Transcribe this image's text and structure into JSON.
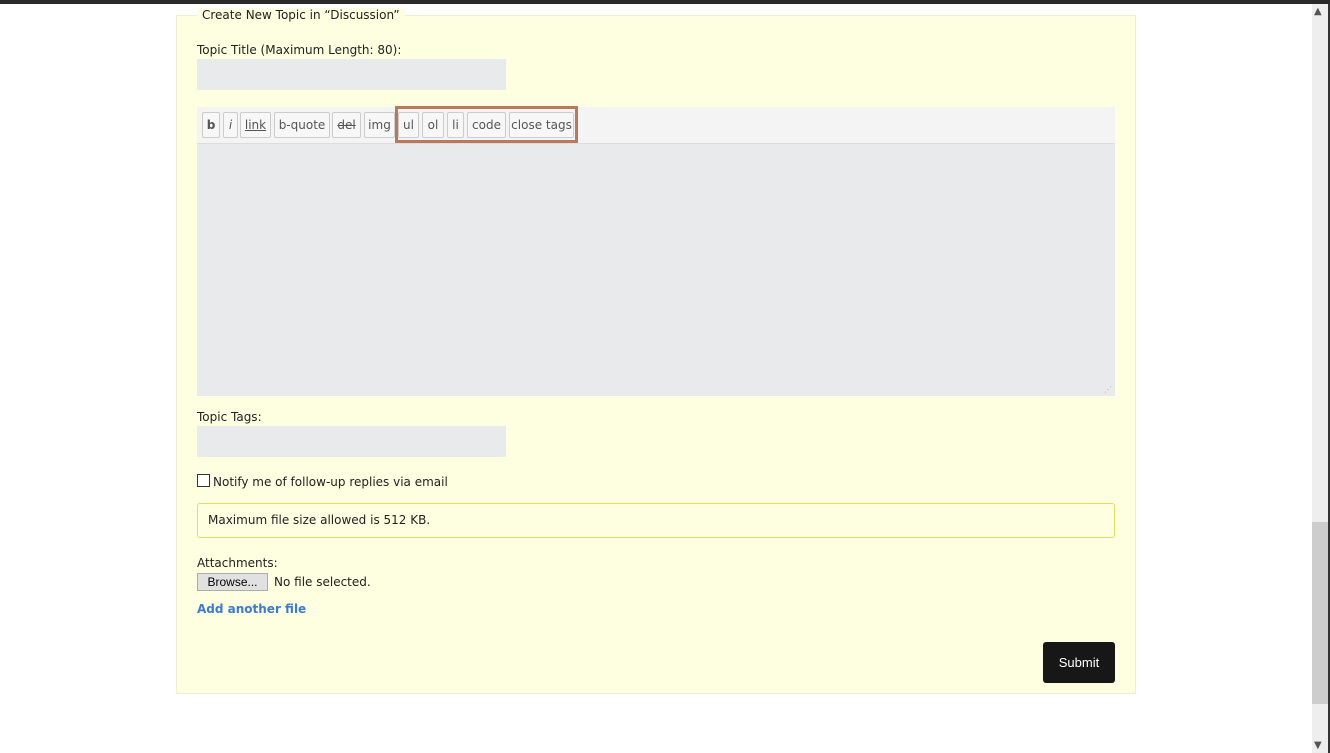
{
  "form": {
    "legend": "Create New Topic in “Discussion”",
    "title_label": "Topic Title (Maximum Length: 80):",
    "title_value": "",
    "toolbar": [
      "b",
      "i",
      "link",
      "b-quote",
      "del",
      "img",
      "ul",
      "ol",
      "li",
      "code",
      "close tags"
    ],
    "body_value": "",
    "tags_label": "Topic Tags:",
    "tags_value": "",
    "notify_label": "Notify me of follow-up replies via email",
    "notify_checked": false,
    "notice": "Maximum file size allowed is 512 KB.",
    "attachments_label": "Attachments:",
    "browse_label": "Browse...",
    "file_status": "No file selected.",
    "add_file_label": "Add another file",
    "submit_label": "Submit"
  },
  "highlight_color": "#b87a5a"
}
